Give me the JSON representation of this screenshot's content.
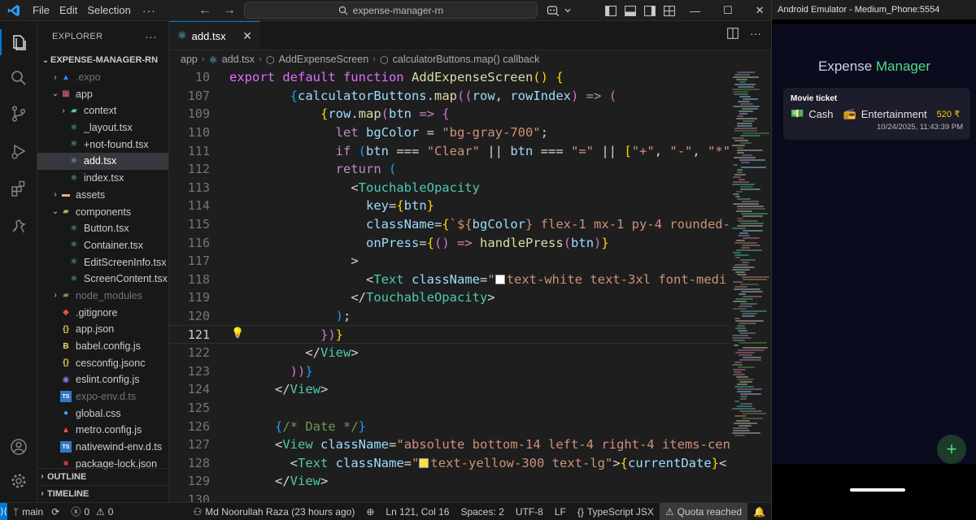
{
  "titlebar": {
    "menu": [
      "File",
      "Edit",
      "Selection"
    ],
    "more": "···",
    "search": "expense-manager-rn",
    "nav_back": "←",
    "nav_forward": "→",
    "minimize": "—",
    "maximize": "☐",
    "close": "✕"
  },
  "explorer": {
    "header": "EXPLORER",
    "more": "···",
    "root": "EXPENSE-MANAGER-RN",
    "items": [
      {
        "label": ".expo"
      },
      {
        "label": "app"
      },
      {
        "label": "context"
      },
      {
        "label": "_layout.tsx"
      },
      {
        "label": "+not-found.tsx"
      },
      {
        "label": "add.tsx"
      },
      {
        "label": "index.tsx"
      },
      {
        "label": "assets"
      },
      {
        "label": "components"
      },
      {
        "label": "Button.tsx"
      },
      {
        "label": "Container.tsx"
      },
      {
        "label": "EditScreenInfo.tsx"
      },
      {
        "label": "ScreenContent.tsx"
      },
      {
        "label": "node_modules"
      },
      {
        "label": ".gitignore"
      },
      {
        "label": "app.json"
      },
      {
        "label": "babel.config.js"
      },
      {
        "label": "cesconfig.jsonc"
      },
      {
        "label": "eslint.config.js"
      },
      {
        "label": "expo-env.d.ts"
      },
      {
        "label": "global.css"
      },
      {
        "label": "metro.config.js"
      },
      {
        "label": "nativewind-env.d.ts"
      },
      {
        "label": "package-lock.json"
      }
    ],
    "outline": "OUTLINE",
    "timeline": "TIMELINE"
  },
  "editor": {
    "tab": "add.tsx",
    "tab_close": "✕",
    "breadcrumb": [
      "app",
      "add.tsx",
      "AddExpenseScreen",
      "calculatorButtons.map() callback"
    ],
    "line_numbers": [
      "10",
      "107",
      "109",
      "110",
      "111",
      "112",
      "113",
      "114",
      "115",
      "116",
      "117",
      "118",
      "119",
      "120",
      "121",
      "122",
      "123",
      "124",
      "125",
      "126",
      "127",
      "128",
      "129",
      "130"
    ],
    "active_line": "121"
  },
  "statusbar": {
    "branch": "main",
    "errors": "0",
    "warnings": "0",
    "author": "Md Noorullah Raza (23 hours ago)",
    "position": "Ln 121, Col 16",
    "spaces": "Spaces: 2",
    "encoding": "UTF-8",
    "eol": "LF",
    "language": "TypeScript JSX",
    "quota": "Quota reached"
  },
  "emulator": {
    "title": "Android Emulator - Medium_Phone:5554",
    "app_title_1": "Expense ",
    "app_title_2": "Manager",
    "card": {
      "title": "Movie ticket",
      "payment": "Cash",
      "category": "Entertainment",
      "amount": "520 ₹",
      "date": "10/24/2025, 11:43:39 PM"
    },
    "fab": "+"
  },
  "colors": {
    "accent": "#0078d4",
    "app_accent": "#4ade80",
    "amount": "#facc15"
  }
}
